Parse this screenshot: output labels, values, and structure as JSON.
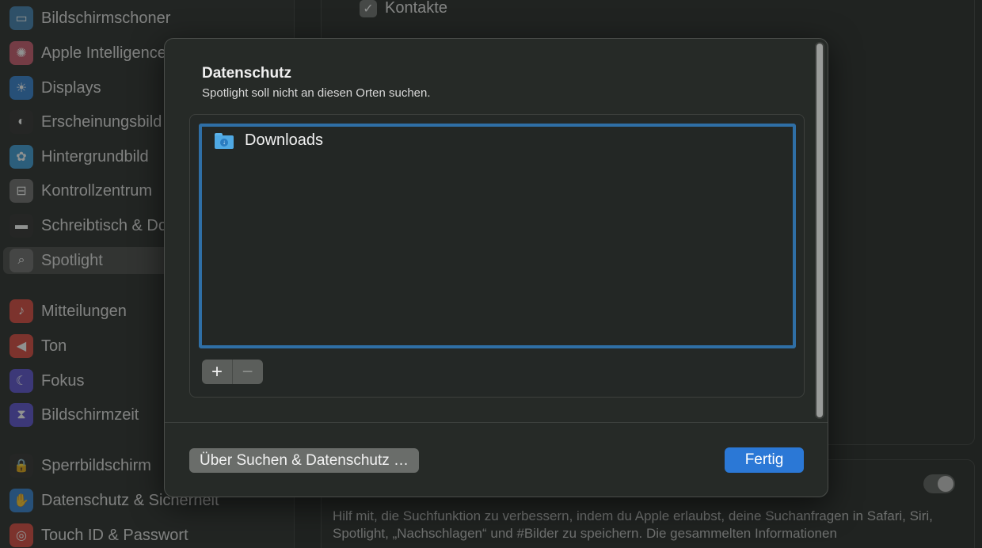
{
  "sidebar": {
    "items": [
      {
        "label": "Bildschirmschoner",
        "icon": "screensaver-icon",
        "color": "#3d7fb0",
        "glyph": "▭"
      },
      {
        "label": "Apple Intelligence & Siri",
        "icon": "apple-intelligence-icon",
        "color": "#c8566b",
        "glyph": "✺"
      },
      {
        "label": "Displays",
        "icon": "displays-icon",
        "color": "#2f7fd0",
        "glyph": "☀"
      },
      {
        "label": "Erscheinungsbild",
        "icon": "appearance-icon",
        "color": "#2b2b2b",
        "glyph": "◐"
      },
      {
        "label": "Hintergrundbild",
        "icon": "wallpaper-icon",
        "color": "#3a9ad6",
        "glyph": "✿"
      },
      {
        "label": "Kontrollzentrum",
        "icon": "control-center-icon",
        "color": "#6b6b6b",
        "glyph": "⊟"
      },
      {
        "label": "Schreibtisch & Dock",
        "icon": "desktop-dock-icon",
        "color": "#2b2b2b",
        "glyph": "▬"
      },
      {
        "label": "Spotlight",
        "icon": "spotlight-icon",
        "color": "#6b6b6b",
        "glyph": "⌕"
      },
      {
        "label": "Mitteilungen",
        "icon": "notifications-icon",
        "color": "#d9443a",
        "glyph": "♪"
      },
      {
        "label": "Ton",
        "icon": "sound-icon",
        "color": "#d9443a",
        "glyph": "◀"
      },
      {
        "label": "Fokus",
        "icon": "focus-icon",
        "color": "#5a4fd0",
        "glyph": "☾"
      },
      {
        "label": "Bildschirmzeit",
        "icon": "screen-time-icon",
        "color": "#5a4fd0",
        "glyph": "⧗"
      },
      {
        "label": "Sperrbildschirm",
        "icon": "lock-screen-icon",
        "color": "#2b2b2b",
        "glyph": "🔒"
      },
      {
        "label": "Datenschutz & Sicherheit",
        "icon": "privacy-hand-icon",
        "color": "#2f7fd0",
        "glyph": "✋"
      },
      {
        "label": "Touch ID & Passwort",
        "icon": "touch-id-icon",
        "color": "#d9443a",
        "glyph": "◎"
      }
    ]
  },
  "main": {
    "checkbox_label": "Kontakte",
    "description": "Hilf mit, die Suchfunktion zu verbessern, indem du Apple erlaubst, deine Suchanfragen in Safari, Siri, Spotlight, „Nachschlagen“ und #Bilder zu speichern. Die gesammelten Informationen"
  },
  "sheet": {
    "title": "Datenschutz",
    "subtitle": "Spotlight soll nicht an diesen Orten suchen.",
    "list": [
      {
        "label": "Downloads",
        "icon": "downloads-folder-icon"
      }
    ],
    "add_glyph": "+",
    "remove_glyph": "−",
    "about_button": "Über Suchen & Datenschutz …",
    "done_button": "Fertig"
  }
}
